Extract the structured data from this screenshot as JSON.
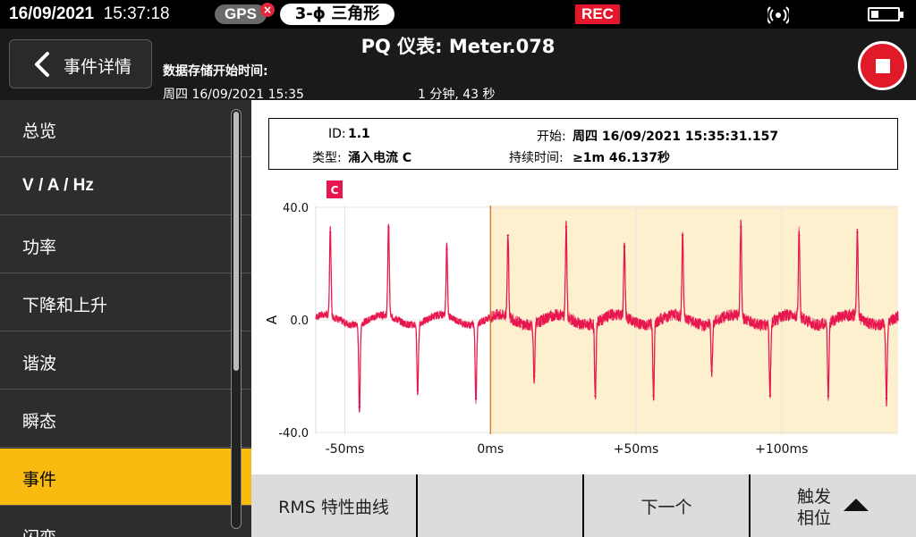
{
  "status": {
    "date": "16/09/2021",
    "time": "15:37:18",
    "gps_label": "GPS",
    "gps_error": "×",
    "phase_label": "3-ϕ 三角形",
    "rec_label": "REC",
    "battery_level": 0.3,
    "icons": [
      "gps-error-icon",
      "wifi-signal-icon",
      "battery-icon"
    ]
  },
  "header": {
    "back_label": "事件详情",
    "title": "PQ 仪表: Meter.078",
    "start_label": "数据存储开始时间:",
    "start_value": "周四 16/09/2021 15:35",
    "duration_value": "1 分钟, 43 秒",
    "icons": [
      "back-arrow-icon",
      "stop-icon"
    ]
  },
  "sidebar": {
    "items": [
      {
        "label": "总览",
        "active": false
      },
      {
        "label": "V / A / Hz",
        "active": false
      },
      {
        "label": "功率",
        "active": false
      },
      {
        "label": "下降和上升",
        "active": false
      },
      {
        "label": "谐波",
        "active": false
      },
      {
        "label": "瞬态",
        "active": false
      },
      {
        "label": "事件",
        "active": true
      },
      {
        "label": "闪变",
        "active": false
      }
    ]
  },
  "event": {
    "id_label": "ID:",
    "id_value": "1.1",
    "type_label": "类型:",
    "type_value": "涌入电流 C",
    "start_label": "开始:",
    "start_value": "周四 16/09/2021 15:35:31.157",
    "duration_label": "持续时间:",
    "duration_value": "≥1m 46.137秒"
  },
  "chart_data": {
    "type": "line",
    "title": "",
    "channel_badge": "C",
    "ylabel": "A",
    "ylim": [
      -40,
      40
    ],
    "y_ticks": [
      "40.0",
      "0.0",
      "-40.0"
    ],
    "xlim": [
      -60,
      140
    ],
    "x_ticks": [
      {
        "value": -50,
        "label": "-50ms"
      },
      {
        "value": 0,
        "label": "0ms"
      },
      {
        "value": 50,
        "label": "+50ms"
      },
      {
        "value": 100,
        "label": "+100ms"
      }
    ],
    "trigger_x": 0,
    "highlight_from": 0,
    "series": [
      {
        "color": "#e8164e",
        "positive_peaks": [
          {
            "x": -55,
            "y": 31
          },
          {
            "x": -35,
            "y": 33
          },
          {
            "x": -15,
            "y": 25
          },
          {
            "x": 6,
            "y": 30
          },
          {
            "x": 26,
            "y": 33
          },
          {
            "x": 46,
            "y": 26
          },
          {
            "x": 66,
            "y": 30
          },
          {
            "x": 86,
            "y": 33
          },
          {
            "x": 106,
            "y": 30
          },
          {
            "x": 126,
            "y": 31
          }
        ],
        "negative_peaks": [
          {
            "x": -45,
            "y": -31
          },
          {
            "x": -25,
            "y": -25
          },
          {
            "x": -5,
            "y": -28
          },
          {
            "x": 15,
            "y": -20
          },
          {
            "x": 36,
            "y": -27
          },
          {
            "x": 56,
            "y": -27
          },
          {
            "x": 76,
            "y": -18
          },
          {
            "x": 96,
            "y": -27
          },
          {
            "x": 116,
            "y": -27
          },
          {
            "x": 136,
            "y": -28
          }
        ]
      }
    ],
    "highlight_color": "#fdf0cf"
  },
  "toolbar": {
    "rms_label": "RMS 特性曲线",
    "empty_label": "",
    "next_label": "下一个",
    "trigger_label_1": "触发",
    "trigger_label_2": "相位"
  }
}
